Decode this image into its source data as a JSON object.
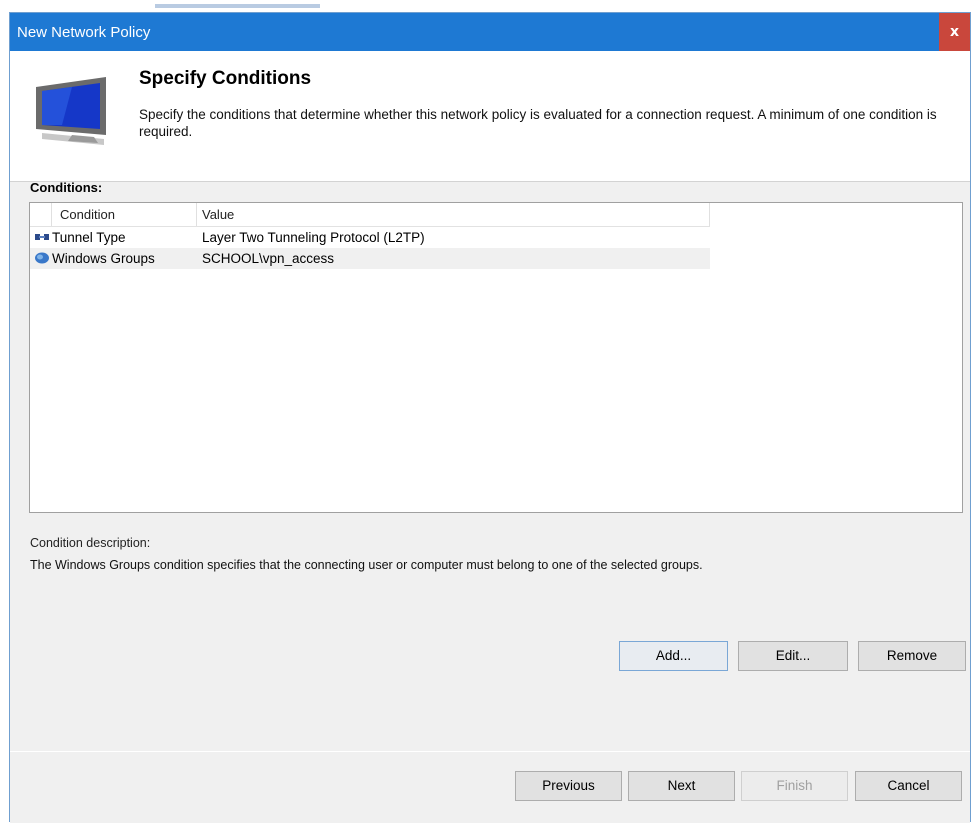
{
  "window": {
    "title": "New Network Policy",
    "close_label": "x"
  },
  "header": {
    "title": "Specify Conditions",
    "description": "Specify the conditions that determine whether this network policy is evaluated for a connection request. A minimum of one condition is required."
  },
  "conditions": {
    "label": "Conditions:",
    "columns": [
      "Condition",
      "Value"
    ],
    "rows": [
      {
        "condition": "Tunnel Type",
        "value": "Layer Two Tunneling Protocol (L2TP)",
        "icon": "tunnel-icon"
      },
      {
        "condition": "Windows Groups",
        "value": "SCHOOL\\vpn_access",
        "icon": "group-icon",
        "selected": true
      }
    ]
  },
  "description": {
    "label": "Condition description:",
    "text": "The Windows Groups condition specifies that the connecting user or computer must belong to one of the selected groups."
  },
  "actions": {
    "add": "Add...",
    "edit": "Edit...",
    "remove": "Remove"
  },
  "footer": {
    "previous": "Previous",
    "next": "Next",
    "finish": "Finish",
    "cancel": "Cancel"
  },
  "colors": {
    "titlebar": "#1e79d3",
    "close": "#c9473c",
    "dialog_bg": "#f0f0f0"
  }
}
